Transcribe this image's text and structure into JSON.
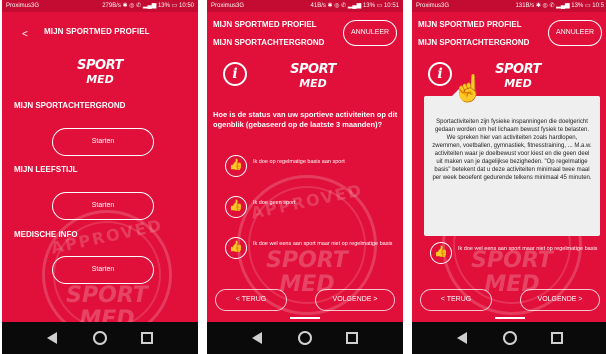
{
  "status_bars": {
    "s1": {
      "carrier": "Proximus3G",
      "right": "279B/s ✱ ◎ ✆ ▂▄▆ 13% ▭ 10:50"
    },
    "s2": {
      "carrier": "Proximus3G",
      "right": "41B/s ✱ ◎ ✆ ▂▄▆ 13% ▭ 10:51"
    },
    "s3": {
      "carrier": "Proximus3G",
      "right": "131B/s ✱ ◎ ✆ ▂▄▆ 13% ▭ 10:5"
    }
  },
  "logo": {
    "line1": "SPORT",
    "line2": "MED"
  },
  "seal": {
    "word": "APPROVED",
    "line1": "SPORT",
    "line2": "MED"
  },
  "screen1": {
    "back_icon": "chevron-left-icon",
    "back_glyph": "<",
    "title": "MIJN SPORTMED PROFIEL",
    "sections": [
      {
        "label": "MIJN SPORTACHTERGROND",
        "button": "Starten"
      },
      {
        "label": "MIJN LEEFSTIJL",
        "button": "Starten"
      },
      {
        "label": "MEDISCHE INFO",
        "button": "Starten"
      }
    ]
  },
  "screen2": {
    "title_line1": "MIJN SPORTMED PROFIEL",
    "title_line2": "MIJN SPORTACHTERGROND",
    "cancel": "ANNULEER",
    "info_glyph": "i",
    "question": "Hoe is de status van uw sportieve activiteiten op dit ogenblik (gebaseerd op de laatste 3 maanden)?",
    "options": [
      "Ik doe op regelmatige basis aan sport",
      "Ik doe geen sport",
      "Ik doe wel eens aan sport maar niet op regelmatige basis"
    ],
    "option_icon": "thumbs-up-icon",
    "prev": "< TERUG",
    "next": "VOLGENDE >"
  },
  "screen3": {
    "title_line1": "MIJN SPORTMED PROFIEL",
    "title_line2": "MIJN SPORTACHTERGROND",
    "cancel": "ANNULEER",
    "info_glyph": "i",
    "tooltip": "Sportactiviteiten zijn fysieke inspanningen die doelgericht gedaan worden om het lichaam bewust fysiek te belasten. We spreken hier van activiteiten zoals hardlopen, zwemmen, voetballen, gymnastiek, fitnesstraining, ... M.a.w. activiteiten waar je doelbewust voor kiest en die geen deel uit maken van je dagelijkse bezigheden. \"Op regelmatige basis\" betekent dat u deze activiteiten minimaal twee maal per week beoefent gedurende telkens minimaal 45 minuten.",
    "option_text": "Ik doe wel eens aan sport maar niet op regelmatige basis",
    "prev": "< TERUG",
    "next": "VOLGENDE >"
  },
  "icons": {
    "back": "back-triangle-icon",
    "home": "home-circle-icon",
    "recent": "recent-square-icon",
    "pointer": "hand-pointer-icon",
    "thumb_glyph": "👍",
    "pointer_glyph": "☝"
  },
  "colors": {
    "brand_red": "#e0103a",
    "status_bar": "#c40b31",
    "nav_bar": "#0a0a0a",
    "tooltip_bg": "#efefef"
  }
}
